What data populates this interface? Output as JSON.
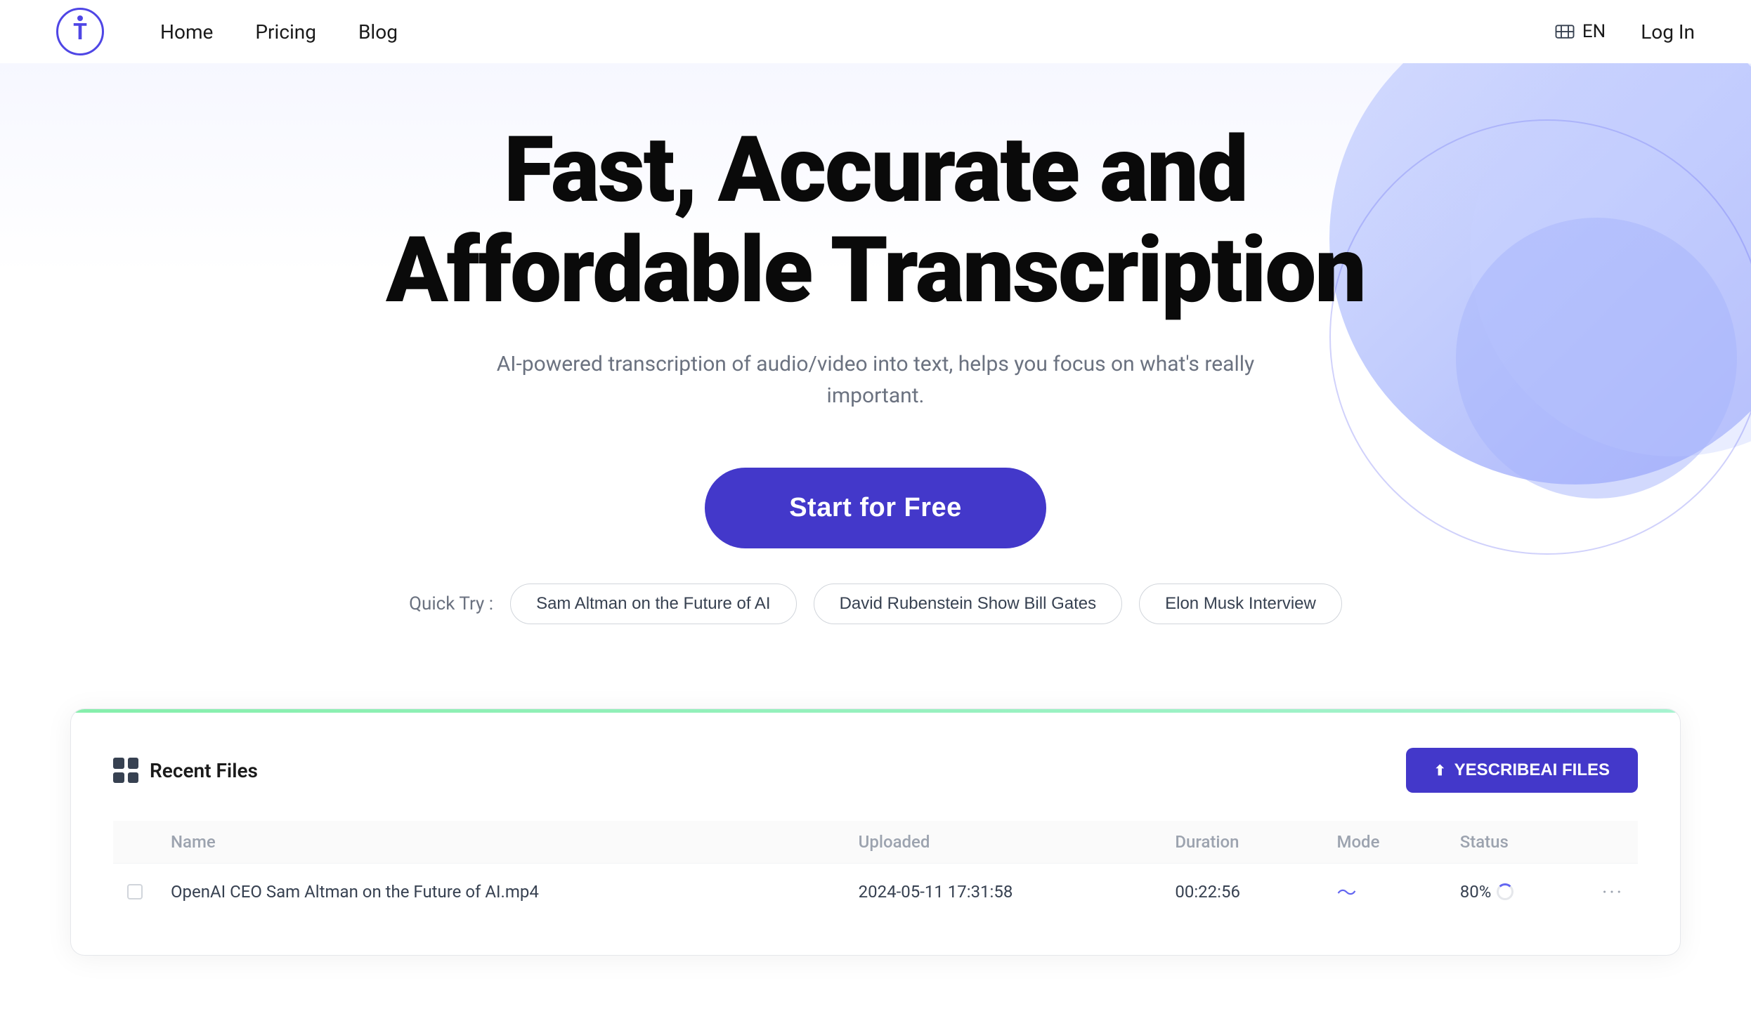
{
  "nav": {
    "logo_letter": "T",
    "links": [
      {
        "label": "Home",
        "id": "home"
      },
      {
        "label": "Pricing",
        "id": "pricing"
      },
      {
        "label": "Blog",
        "id": "blog"
      }
    ],
    "lang": "EN",
    "login": "Log In"
  },
  "hero": {
    "title": "Fast, Accurate and Affordable Transcription",
    "subtitle": "AI-powered transcription of audio/video into text, helps you focus on what's really important.",
    "cta_label": "Start for Free",
    "quick_try_label": "Quick Try :",
    "quick_try_chips": [
      "Sam Altman on the Future of AI",
      "David Rubenstein Show Bill Gates",
      "Elon Musk Interview"
    ]
  },
  "demo": {
    "progress_color": "#86efac",
    "recent_files_label": "Recent Files",
    "upload_btn_label": "YESCRIBEAI FILES",
    "table": {
      "columns": [
        "Name",
        "Uploaded",
        "Duration",
        "Mode",
        "Status"
      ],
      "rows": [
        {
          "name": "OpenAI CEO Sam Altman on the Future of AI.mp4",
          "uploaded": "2024-05-11 17:31:58",
          "duration": "00:22:56",
          "mode": "wave",
          "status": "80%",
          "more": "···"
        }
      ]
    }
  }
}
